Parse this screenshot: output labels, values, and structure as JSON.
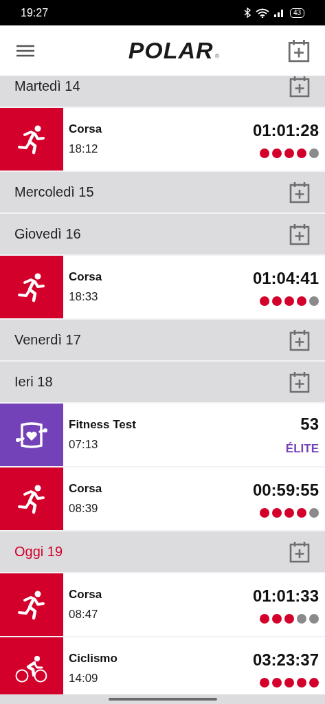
{
  "status_bar": {
    "time": "19:27",
    "battery": "43"
  },
  "header": {
    "logo": "POLAR",
    "logo_mark": "®"
  },
  "days": [
    {
      "label": "Martedì 14",
      "today": false,
      "activities": [
        {
          "kind": "run",
          "name": "Corsa",
          "time": "18:12",
          "value": "01:01:28",
          "stars": 4
        }
      ]
    },
    {
      "label": "Mercoledì 15",
      "today": false
    },
    {
      "label": "Giovedì 16",
      "today": false,
      "activities": [
        {
          "kind": "run",
          "name": "Corsa",
          "time": "18:33",
          "value": "01:04:41",
          "stars": 4
        }
      ]
    },
    {
      "label": "Venerdì 17",
      "today": false
    },
    {
      "label": "Ieri 18",
      "today": false,
      "activities": [
        {
          "kind": "fitness_test",
          "name": "Fitness Test",
          "time": "07:13",
          "value": "53",
          "rating": "ÉLITE"
        },
        {
          "kind": "run",
          "name": "Corsa",
          "time": "08:39",
          "value": "00:59:55",
          "stars": 4
        }
      ]
    },
    {
      "label": "Oggi 19",
      "today": true,
      "activities": [
        {
          "kind": "run",
          "name": "Corsa",
          "time": "08:47",
          "value": "01:01:33",
          "stars": 3
        },
        {
          "kind": "cycle",
          "name": "Ciclismo",
          "time": "14:09",
          "value": "03:23:37",
          "stars": 5
        }
      ]
    }
  ]
}
